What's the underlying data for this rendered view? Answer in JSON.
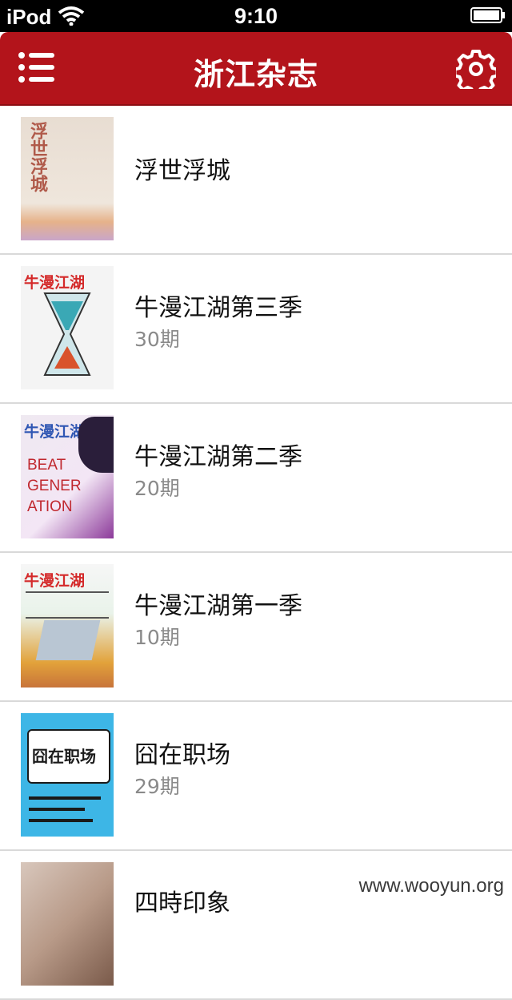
{
  "status_bar": {
    "device": "iPod",
    "time": "9:10"
  },
  "nav": {
    "title": "浙江杂志"
  },
  "items": [
    {
      "title": "浮世浮城",
      "subtitle": "",
      "cover": {
        "bg": "#e8ddd2",
        "accent": "#d9a07a",
        "mast": "浮世浮城",
        "mast_color": "#b05a4a"
      }
    },
    {
      "title": "牛漫江湖第三季",
      "subtitle": "30期",
      "cover": {
        "bg": "#f4f4f4",
        "accent": "#3aa8b5",
        "mast": "牛漫江湖",
        "mast_color": "#d42a2a"
      }
    },
    {
      "title": "牛漫江湖第二季",
      "subtitle": "20期",
      "cover": {
        "bg": "#efe9f1",
        "accent": "#8c3a9a",
        "mast": "牛漫江湖",
        "mast_color": "#2f56b3"
      }
    },
    {
      "title": "牛漫江湖第一季",
      "subtitle": "10期",
      "cover": {
        "bg": "#e9f3ea",
        "accent": "#e2a23a",
        "mast": "牛漫江湖",
        "mast_color": "#d42a2a"
      }
    },
    {
      "title": "囧在职场",
      "subtitle": "29期",
      "cover": {
        "bg": "#3db6e6",
        "accent": "#ffffff",
        "mast": "囧在职场",
        "mast_color": "#1a1a1a"
      }
    },
    {
      "title": "四時印象",
      "subtitle": "",
      "cover": {
        "bg": "#d8c7bc",
        "accent": "#7a5a4a",
        "mast": "",
        "mast_color": "#333333"
      }
    }
  ],
  "watermark": "www.wooyun.org",
  "colors": {
    "nav_bg": "#b3141b",
    "divider": "#d9d9d9",
    "subtitle": "#8a8a8a"
  }
}
